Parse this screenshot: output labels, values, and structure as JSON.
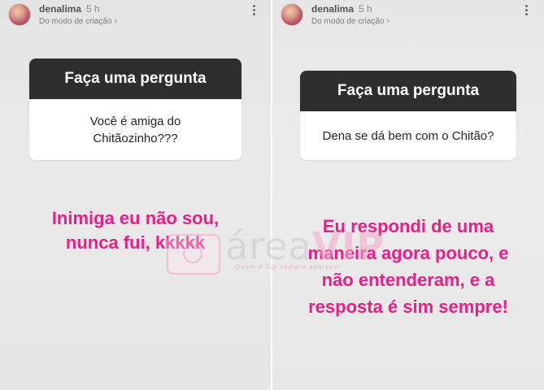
{
  "stories": [
    {
      "username": "denalima",
      "time": "5 h",
      "subtitle": "Do modo de criação",
      "question_title": "Faça uma pergunta",
      "question_text": "Você é amiga do Chitãozinho???",
      "answer_lines": [
        "Inimiga eu não sou,",
        "nunca fui, kkkkk"
      ]
    },
    {
      "username": "denalima",
      "time": "5 h",
      "subtitle": "Do modo de criação",
      "question_title": "Faça uma pergunta",
      "question_text": "Dena se dá bem com o Chitão?",
      "answer_lines": [
        "Eu respondi de uma",
        "maneira agora pouco, e",
        "não entenderam, e a",
        "resposta é sim sempre!"
      ]
    }
  ],
  "watermark": {
    "brand_prefix": "área",
    "brand_suffix": "VIP",
    "tagline": "Quem é Vip sempre aparece!"
  },
  "colors": {
    "answer_pink": "#ea1e84",
    "question_header": "#2e2e2e"
  }
}
